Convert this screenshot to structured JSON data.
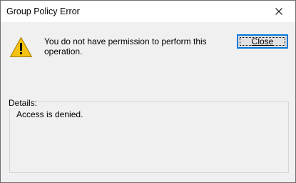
{
  "window": {
    "title": "Group Policy Error"
  },
  "dialog": {
    "message": "You do not have permission to perform this operation.",
    "close_button_label": "Close",
    "details_label": "Details:",
    "details_text": "Access is denied."
  },
  "icons": {
    "warning": "warning-icon",
    "titlebar_close": "close-icon"
  },
  "colors": {
    "title_bar": "#ffffff",
    "dialog_background": "#f0f0f0",
    "button_focus_border": "#0078d7",
    "warning_fill": "#f5c211"
  }
}
